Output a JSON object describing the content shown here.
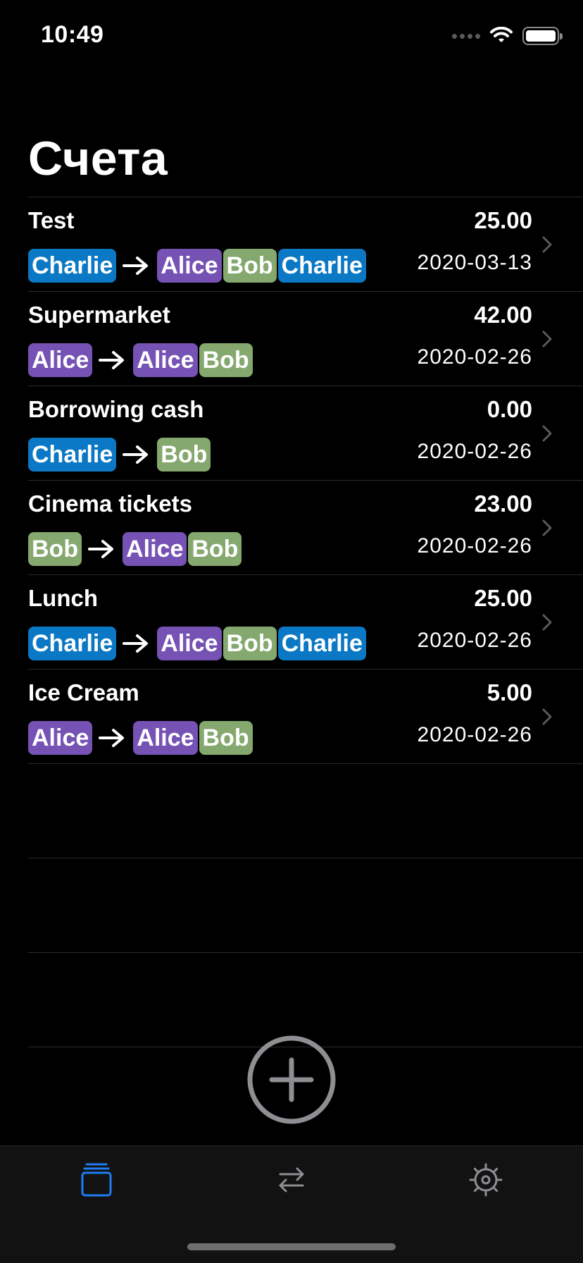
{
  "status": {
    "time": "10:49"
  },
  "title": "Счета",
  "colors": {
    "Charlie": "#0a78c4",
    "Alice": "#7652b4",
    "Bob": "#84a86e"
  },
  "bills": [
    {
      "name": "Test",
      "amount": "25.00",
      "date": "2020-03-13",
      "payer": "Charlie",
      "participants": [
        "Alice",
        "Bob",
        "Charlie"
      ]
    },
    {
      "name": "Supermarket",
      "amount": "42.00",
      "date": "2020-02-26",
      "payer": "Alice",
      "participants": [
        "Alice",
        "Bob"
      ]
    },
    {
      "name": "Borrowing cash",
      "amount": "0.00",
      "date": "2020-02-26",
      "payer": "Charlie",
      "participants": [
        "Bob"
      ]
    },
    {
      "name": "Cinema tickets",
      "amount": "23.00",
      "date": "2020-02-26",
      "payer": "Bob",
      "participants": [
        "Alice",
        "Bob"
      ]
    },
    {
      "name": "Lunch",
      "amount": "25.00",
      "date": "2020-02-26",
      "payer": "Charlie",
      "participants": [
        "Alice",
        "Bob",
        "Charlie"
      ]
    },
    {
      "name": "Ice Cream",
      "amount": "5.00",
      "date": "2020-02-26",
      "payer": "Alice",
      "participants": [
        "Alice",
        "Bob"
      ]
    }
  ],
  "icons": {
    "add": "plus-circle-icon",
    "tab_bills": "stack-icon",
    "tab_transfers": "arrows-exchange-icon",
    "tab_settings": "gear-icon"
  },
  "tabs": {
    "active": "bills",
    "active_color": "#1f7cf3",
    "inactive_color": "#8e8e93"
  }
}
